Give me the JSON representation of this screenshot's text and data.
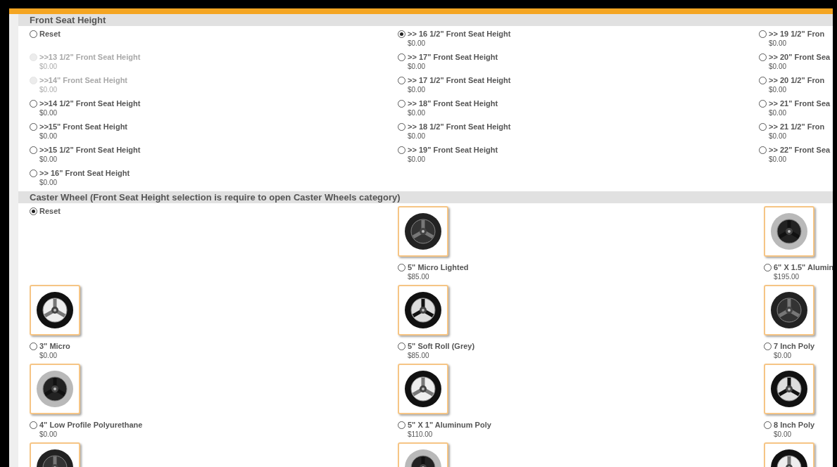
{
  "sections": [
    {
      "kind": "list",
      "title": "Front Seat Height",
      "columns": [
        [
          {
            "label": "Reset",
            "selected": false,
            "disabled": false
          },
          {
            "label": ">>13 1/2\" Front Seat Height",
            "price": "$0.00",
            "selected": false,
            "disabled": true
          },
          {
            "label": ">>14\" Front Seat Height",
            "price": "$0.00",
            "selected": false,
            "disabled": true
          },
          {
            "label": ">>14 1/2\" Front Seat Height",
            "price": "$0.00",
            "selected": false,
            "disabled": false
          },
          {
            "label": ">>15\" Front Seat Height",
            "price": "$0.00",
            "selected": false,
            "disabled": false
          },
          {
            "label": ">>15 1/2\" Front Seat Height",
            "price": "$0.00",
            "selected": false,
            "disabled": false
          },
          {
            "label": ">> 16\" Front Seat Height",
            "price": "$0.00",
            "selected": false,
            "disabled": false
          }
        ],
        [
          {
            "label": ">> 16 1/2\" Front Seat Height",
            "price": "$0.00",
            "selected": true,
            "disabled": false
          },
          {
            "label": ">> 17\" Front Seat Height",
            "price": "$0.00",
            "selected": false,
            "disabled": false
          },
          {
            "label": ">> 17 1/2\" Front Seat Height",
            "price": "$0.00",
            "selected": false,
            "disabled": false
          },
          {
            "label": ">> 18\" Front Seat Height",
            "price": "$0.00",
            "selected": false,
            "disabled": false
          },
          {
            "label": ">> 18 1/2\" Front Seat Height",
            "price": "$0.00",
            "selected": false,
            "disabled": false
          },
          {
            "label": ">> 19\" Front Seat Height",
            "price": "$0.00",
            "selected": false,
            "disabled": false
          }
        ],
        [
          {
            "label": ">> 19 1/2\" Fron",
            "price": "$0.00",
            "selected": false,
            "disabled": false
          },
          {
            "label": ">> 20\" Front Sea",
            "price": "$0.00",
            "selected": false,
            "disabled": false
          },
          {
            "label": ">> 20 1/2\" Fron",
            "price": "$0.00",
            "selected": false,
            "disabled": false
          },
          {
            "label": ">> 21\" Front Sea",
            "price": "$0.00",
            "selected": false,
            "disabled": false
          },
          {
            "label": ">> 21 1/2\" Fron",
            "price": "$0.00",
            "selected": false,
            "disabled": false
          },
          {
            "label": ">> 22\" Front Sea",
            "price": "$0.00",
            "selected": false,
            "disabled": false
          }
        ]
      ]
    },
    {
      "kind": "gallery",
      "title": "Caster Wheel (Front Seat Height selection is require to open Caster Wheels category)",
      "options": [
        {
          "kind": "reset",
          "label": "Reset",
          "selected": true
        },
        {
          "kind": "wheel",
          "label": "5\" Micro Lighted",
          "price": "$85.00",
          "selected": false
        },
        {
          "kind": "wheel",
          "label": "6\" X 1.5\" Alumin",
          "price": "$195.00",
          "selected": false
        },
        {
          "kind": "wheel",
          "label": "3\" Micro",
          "price": "$0.00",
          "selected": false
        },
        {
          "kind": "wheel",
          "label": "5\" Soft Roll (Grey)",
          "price": "$85.00",
          "selected": false
        },
        {
          "kind": "wheel",
          "label": "7 Inch Poly",
          "price": "$0.00",
          "selected": false
        },
        {
          "kind": "wheel",
          "label": "4\" Low Profile Polyurethane",
          "price": "$0.00",
          "selected": false
        },
        {
          "kind": "wheel",
          "label": "5\" X 1\" Aluminum Poly",
          "price": "$110.00",
          "selected": false
        },
        {
          "kind": "wheel",
          "label": "8 Inch Poly",
          "price": "$0.00",
          "selected": false
        },
        {
          "kind": "cut"
        },
        {
          "kind": "cut"
        },
        {
          "kind": "cut"
        }
      ]
    }
  ]
}
